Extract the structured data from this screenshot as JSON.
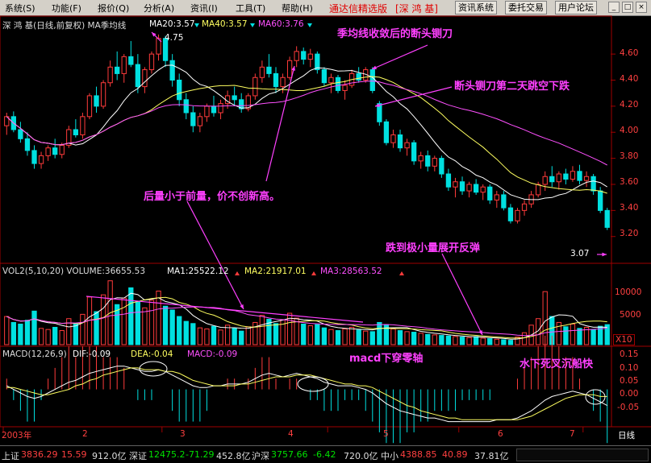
{
  "menu": {
    "items": [
      "系统(S)",
      "功能(F)",
      "报价(Q)",
      "分析(A)",
      "资讯(I)",
      "工具(T)",
      "帮助(H)"
    ],
    "brand": "通达信精选版",
    "stock_tag": "[深 鸿 基]",
    "buttons": [
      "资讯系统",
      "委托交易",
      "用户论坛"
    ],
    "win_buttons": [
      "_",
      "□",
      "×"
    ]
  },
  "price_panel": {
    "title": "深 鸿 基(日线,前复权) MA季均线",
    "ma20": "MA20:3.57",
    "ma40": "MA40:3.57",
    "ma60": "MA60:3.76",
    "high_label": "4.75",
    "low_label": "3.07",
    "y_ticks": [
      "4.60",
      "4.40",
      "4.20",
      "4.00",
      "3.80",
      "3.60",
      "3.40",
      "3.20"
    ],
    "ylim": [
      3.05,
      4.78
    ]
  },
  "volume_panel": {
    "title": "VOL2(5,10,20) VOLUME:36655.53",
    "ma1": "MA1:25522.12",
    "ma2": "MA2:21917.01",
    "ma3": "MA3:28563.52",
    "y_ticks": [
      "10000",
      "5000"
    ],
    "unit": "X10"
  },
  "macd_panel": {
    "title": "MACD(12,26,9)",
    "dif": "DIF:-0.09",
    "dea": "DEA:-0.04",
    "macd": "MACD:-0.09",
    "y_ticks": [
      "0.15",
      "0.10",
      "0.05",
      "0.00",
      "-0.05"
    ]
  },
  "x_axis": {
    "labels": [
      "2003年",
      "2",
      "3",
      "4",
      "5",
      "6",
      "7"
    ],
    "period": "日线"
  },
  "annotations": {
    "a1": "季均线收敛后的断头铡刀",
    "a2": "断头铡刀第二天跳空下跌",
    "a3": "后量小于前量，价不创新高。",
    "a4": "跌到极小量展开反弹",
    "a5": "macd下穿零轴",
    "a6": "水下死叉沉船快"
  },
  "status": {
    "sh_label": "上证",
    "sh_value": "3836.29",
    "sh_change": "15.59",
    "sh_amount": "912.0亿",
    "sz_label": "深证",
    "sz_value": "12475.2",
    "sz_change": "-71.29",
    "sz_amount": "452.8亿",
    "hs_label": "沪深",
    "hs_value": "3757.66",
    "hs_change": "-6.42",
    "hs_amount": "720.0亿",
    "zx_label": "中小",
    "zx_value": "4388.85",
    "zx_change": "40.89",
    "zx_amount": "37.81亿"
  },
  "colors": {
    "up": "#ff3b3b",
    "down": "#00e0e0",
    "ma_yellow": "#ffff60",
    "ma_white": "#ffffff",
    "ma_magenta": "#ff50ff",
    "grid": "#a00000",
    "annotation": "#ff40ff"
  },
  "chart_data": {
    "type": "candlestick",
    "title": "深 鸿 基(日线,前复权) MA季均线",
    "ohlc": [
      [
        4.05,
        4.15,
        3.98,
        4.12
      ],
      [
        4.12,
        4.16,
        4.0,
        4.02
      ],
      [
        4.02,
        4.08,
        3.92,
        3.95
      ],
      [
        3.95,
        4.0,
        3.82,
        3.86
      ],
      [
        3.86,
        3.9,
        3.72,
        3.76
      ],
      [
        3.76,
        3.85,
        3.72,
        3.82
      ],
      [
        3.82,
        3.9,
        3.78,
        3.88
      ],
      [
        3.88,
        3.95,
        3.8,
        3.83
      ],
      [
        3.83,
        3.92,
        3.8,
        3.9
      ],
      [
        3.9,
        4.05,
        3.88,
        4.02
      ],
      [
        4.02,
        4.1,
        3.96,
        3.98
      ],
      [
        3.98,
        4.15,
        3.95,
        4.12
      ],
      [
        4.12,
        4.3,
        4.1,
        4.28
      ],
      [
        4.28,
        4.35,
        4.15,
        4.2
      ],
      [
        4.2,
        4.4,
        4.18,
        4.38
      ],
      [
        4.38,
        4.55,
        4.35,
        4.5
      ],
      [
        4.5,
        4.62,
        4.4,
        4.45
      ],
      [
        4.45,
        4.6,
        4.38,
        4.58
      ],
      [
        4.58,
        4.7,
        4.5,
        4.52
      ],
      [
        4.52,
        4.6,
        4.3,
        4.35
      ],
      [
        4.35,
        4.5,
        4.3,
        4.48
      ],
      [
        4.48,
        4.62,
        4.45,
        4.6
      ],
      [
        4.6,
        4.75,
        4.55,
        4.72
      ],
      [
        4.72,
        4.74,
        4.5,
        4.55
      ],
      [
        4.55,
        4.6,
        4.35,
        4.4
      ],
      [
        4.4,
        4.45,
        4.2,
        4.25
      ],
      [
        4.25,
        4.3,
        4.1,
        4.15
      ],
      [
        4.15,
        4.2,
        4.0,
        4.05
      ],
      [
        4.05,
        4.15,
        4.0,
        4.12
      ],
      [
        4.12,
        4.22,
        4.08,
        4.2
      ],
      [
        4.2,
        4.28,
        4.12,
        4.15
      ],
      [
        4.15,
        4.25,
        4.1,
        4.22
      ],
      [
        4.22,
        4.32,
        4.18,
        4.28
      ],
      [
        4.28,
        4.35,
        4.2,
        4.25
      ],
      [
        4.25,
        4.3,
        4.15,
        4.18
      ],
      [
        4.18,
        4.3,
        4.16,
        4.28
      ],
      [
        4.28,
        4.45,
        4.25,
        4.42
      ],
      [
        4.42,
        4.55,
        4.38,
        4.5
      ],
      [
        4.5,
        4.6,
        4.42,
        4.45
      ],
      [
        4.45,
        4.5,
        4.3,
        4.35
      ],
      [
        4.35,
        4.45,
        4.3,
        4.42
      ],
      [
        4.42,
        4.58,
        4.4,
        4.55
      ],
      [
        4.55,
        4.66,
        4.5,
        4.62
      ],
      [
        4.62,
        4.65,
        4.52,
        4.56
      ],
      [
        4.56,
        4.64,
        4.5,
        4.6
      ],
      [
        4.6,
        4.62,
        4.45,
        4.48
      ],
      [
        4.48,
        4.5,
        4.35,
        4.38
      ],
      [
        4.38,
        4.45,
        4.3,
        4.42
      ],
      [
        4.42,
        4.44,
        4.3,
        4.32
      ],
      [
        4.32,
        4.4,
        4.25,
        4.36
      ],
      [
        4.36,
        4.48,
        4.34,
        4.45
      ],
      [
        4.45,
        4.5,
        4.38,
        4.4
      ],
      [
        4.4,
        4.5,
        4.38,
        4.48
      ],
      [
        4.48,
        4.5,
        4.3,
        4.32
      ],
      [
        4.22,
        4.24,
        4.05,
        4.08
      ],
      [
        4.08,
        4.1,
        3.9,
        3.92
      ],
      [
        3.92,
        4.02,
        3.88,
        3.98
      ],
      [
        3.98,
        4.02,
        3.85,
        3.88
      ],
      [
        3.88,
        3.95,
        3.82,
        3.92
      ],
      [
        3.92,
        3.94,
        3.75,
        3.78
      ],
      [
        3.78,
        3.85,
        3.72,
        3.82
      ],
      [
        3.82,
        3.86,
        3.7,
        3.74
      ],
      [
        3.74,
        3.82,
        3.7,
        3.8
      ],
      [
        3.8,
        3.82,
        3.65,
        3.68
      ],
      [
        3.68,
        3.72,
        3.55,
        3.58
      ],
      [
        3.58,
        3.65,
        3.5,
        3.62
      ],
      [
        3.62,
        3.66,
        3.52,
        3.55
      ],
      [
        3.55,
        3.62,
        3.5,
        3.6
      ],
      [
        3.6,
        3.64,
        3.52,
        3.54
      ],
      [
        3.54,
        3.6,
        3.48,
        3.58
      ],
      [
        3.58,
        3.6,
        3.45,
        3.48
      ],
      [
        3.48,
        3.55,
        3.42,
        3.52
      ],
      [
        3.52,
        3.55,
        3.4,
        3.42
      ],
      [
        3.42,
        3.45,
        3.3,
        3.32
      ],
      [
        3.32,
        3.42,
        3.3,
        3.4
      ],
      [
        3.4,
        3.48,
        3.36,
        3.45
      ],
      [
        3.45,
        3.55,
        3.42,
        3.52
      ],
      [
        3.52,
        3.62,
        3.5,
        3.6
      ],
      [
        3.6,
        3.7,
        3.55,
        3.66
      ],
      [
        3.66,
        3.74,
        3.58,
        3.62
      ],
      [
        3.62,
        3.7,
        3.56,
        3.68
      ],
      [
        3.68,
        3.72,
        3.6,
        3.64
      ],
      [
        3.64,
        3.74,
        3.62,
        3.7
      ],
      [
        3.7,
        3.75,
        3.6,
        3.63
      ],
      [
        3.63,
        3.7,
        3.58,
        3.66
      ],
      [
        3.66,
        3.68,
        3.52,
        3.55
      ],
      [
        3.55,
        3.58,
        3.38,
        3.4
      ],
      [
        3.4,
        3.42,
        3.25,
        3.27
      ]
    ],
    "volume": [
      5200,
      4100,
      3800,
      4500,
      6200,
      3000,
      2800,
      3200,
      2600,
      4800,
      3900,
      5600,
      8800,
      6100,
      9200,
      11800,
      7400,
      8600,
      10500,
      7900,
      6800,
      8200,
      9900,
      7100,
      6400,
      5200,
      4300,
      3900,
      3100,
      2900,
      3400,
      2700,
      3600,
      3000,
      2500,
      3300,
      4100,
      5400,
      4700,
      3900,
      4600,
      5800,
      4900,
      3800,
      3500,
      3700,
      3100,
      2800,
      2600,
      2900,
      3200,
      2700,
      2500,
      2400,
      4100,
      3700,
      2900,
      2600,
      2400,
      2300,
      2100,
      1900,
      1800,
      1700,
      1600,
      1500,
      1400,
      1300,
      1500,
      1200,
      1100,
      1000,
      900,
      800,
      1400,
      2200,
      3600,
      4800,
      9800,
      5200,
      4100,
      3300,
      3800,
      3000,
      3200,
      2800,
      3400,
      3700
    ],
    "macd": {
      "dif": [
        0.02,
        0.0,
        -0.02,
        -0.04,
        -0.05,
        -0.04,
        -0.02,
        0.0,
        0.02,
        0.04,
        0.05,
        0.07,
        0.09,
        0.1,
        0.11,
        0.12,
        0.13,
        0.13,
        0.12,
        0.11,
        0.1,
        0.1,
        0.11,
        0.1,
        0.08,
        0.06,
        0.04,
        0.02,
        0.01,
        0.01,
        0.02,
        0.02,
        0.03,
        0.03,
        0.03,
        0.04,
        0.06,
        0.08,
        0.09,
        0.08,
        0.07,
        0.08,
        0.09,
        0.08,
        0.07,
        0.06,
        0.04,
        0.03,
        0.02,
        0.02,
        0.02,
        0.01,
        0.0,
        -0.02,
        -0.05,
        -0.08,
        -0.1,
        -0.12,
        -0.13,
        -0.14,
        -0.15,
        -0.16,
        -0.16,
        -0.17,
        -0.18,
        -0.18,
        -0.18,
        -0.18,
        -0.18,
        -0.18,
        -0.18,
        -0.17,
        -0.17,
        -0.17,
        -0.16,
        -0.14,
        -0.12,
        -0.09,
        -0.06,
        -0.04,
        -0.03,
        -0.02,
        -0.01,
        -0.02,
        -0.03,
        -0.05,
        -0.07,
        -0.09
      ],
      "dea": [
        0.01,
        0.01,
        0.0,
        -0.01,
        -0.02,
        -0.03,
        -0.03,
        -0.02,
        -0.01,
        0.0,
        0.02,
        0.03,
        0.05,
        0.06,
        0.08,
        0.09,
        0.1,
        0.11,
        0.12,
        0.12,
        0.11,
        0.11,
        0.11,
        0.1,
        0.1,
        0.09,
        0.07,
        0.05,
        0.04,
        0.03,
        0.02,
        0.02,
        0.02,
        0.02,
        0.03,
        0.03,
        0.04,
        0.05,
        0.06,
        0.07,
        0.07,
        0.07,
        0.08,
        0.08,
        0.08,
        0.07,
        0.06,
        0.05,
        0.04,
        0.03,
        0.03,
        0.02,
        0.02,
        0.01,
        -0.01,
        -0.03,
        -0.05,
        -0.07,
        -0.09,
        -0.1,
        -0.12,
        -0.13,
        -0.14,
        -0.15,
        -0.16,
        -0.16,
        -0.17,
        -0.17,
        -0.17,
        -0.17,
        -0.17,
        -0.17,
        -0.17,
        -0.17,
        -0.17,
        -0.16,
        -0.15,
        -0.13,
        -0.11,
        -0.09,
        -0.07,
        -0.05,
        -0.04,
        -0.03,
        -0.03,
        -0.03,
        -0.04,
        -0.04
      ]
    }
  }
}
